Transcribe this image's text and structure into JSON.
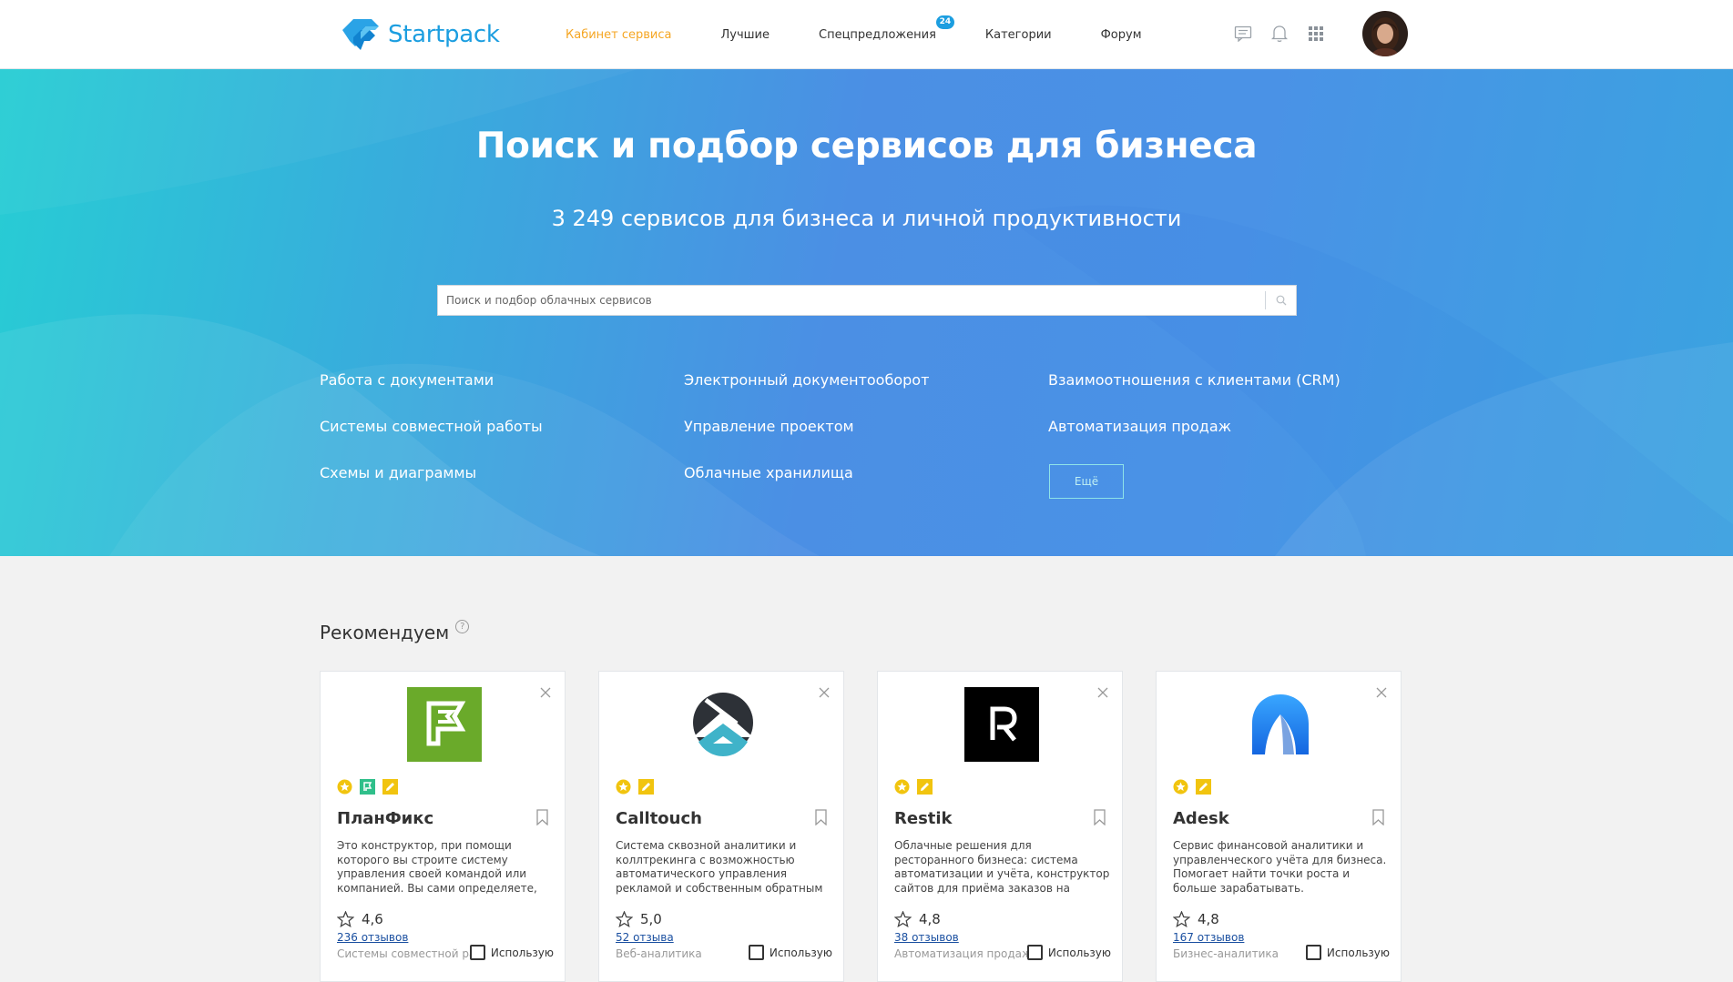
{
  "header": {
    "logo_text": "Startpack",
    "nav": [
      {
        "label": "Кабинет сервиса",
        "active": true
      },
      {
        "label": "Лучшие"
      },
      {
        "label": "Спецпредложения",
        "badge": "24"
      },
      {
        "label": "Категории"
      },
      {
        "label": "Форум"
      }
    ],
    "icons": [
      "chat-icon",
      "bell-icon",
      "apps-grid-icon"
    ]
  },
  "hero": {
    "title": "Поиск и подбор сервисов для бизнеса",
    "subtitle": "3 249 сервисов для бизнеса и личной продуктивности",
    "search_placeholder": "Поиск и подбор облачных сервисов",
    "categories": [
      "Работа с документами",
      "Электронный документооборот",
      "Взаимоотношения с клиентами (CRM)",
      "Системы совместной работы",
      "Управление проектом",
      "Автоматизация продаж",
      "Схемы и диаграммы",
      "Облачные хранилища"
    ],
    "more_label": "Ещё"
  },
  "recommend": {
    "title": "Рекомендуем",
    "help": "?",
    "cards": [
      {
        "name": "ПланФикс",
        "description": "Это конструктор, при помощи которого вы строите систему управления своей командой или компанией. Вы сами определяете,",
        "rating": "4,6",
        "reviews": "236 отзывов",
        "category": "Системы совместной работы",
        "use_label": "Использую",
        "logo_color": "#6aaa2a",
        "badges": [
          "star-badge",
          "planfix-badge",
          "edit-badge"
        ]
      },
      {
        "name": "Calltouch",
        "description": "Система сквозной аналитики и коллтрекинга с возможностью автоматического управления рекламой и собственным обратным",
        "rating": "5,0",
        "reviews": "52 отзыва",
        "category": "Веб-аналитика",
        "use_label": "Использую",
        "logo_color": "#2d3137",
        "badges": [
          "star-badge",
          "edit-badge"
        ]
      },
      {
        "name": "Restik",
        "description": "Облачные решения для ресторанного бизнеса: система автоматизации и учёта, конструктор сайтов для приёма заказов на доставку, самовывоз и в",
        "rating": "4,8",
        "reviews": "38 отзывов",
        "category": "Автоматизация продаж",
        "use_label": "Использую",
        "logo_color": "#000000",
        "badges": [
          "star-badge",
          "edit-badge"
        ]
      },
      {
        "name": "Adesk",
        "description": "Сервис финансовой аналитики и управленческого учёта для бизнеса. Помогает найти точки роста и больше зарабатывать.",
        "rating": "4,8",
        "reviews": "167 отзывов",
        "category": "Бизнес-аналитика",
        "use_label": "Использую",
        "logo_color": "#1c7ef0",
        "badges": [
          "star-badge",
          "edit-badge"
        ]
      }
    ]
  },
  "colors": {
    "accent": "#f5a623",
    "brand": "#1c9ee0",
    "link": "#1a4fa0",
    "hero_start": "#27cdd4",
    "hero_end": "#4b8fe4"
  }
}
